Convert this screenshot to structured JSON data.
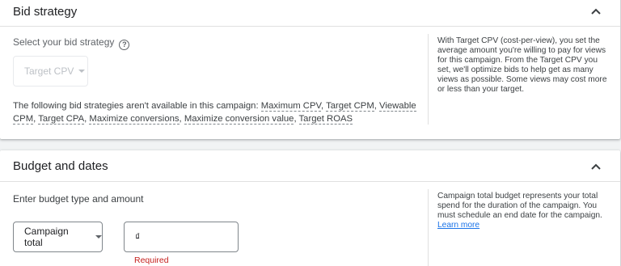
{
  "bid_strategy": {
    "title": "Bid strategy",
    "select_label": "Select your bid strategy",
    "help_glyph": "?",
    "selected": "Target CPV",
    "unavailable_prefix": "The following bid strategies aren't available in this campaign: ",
    "unavailable": [
      "Maximum CPV",
      "Target CPM",
      "Viewable CPM",
      "Target CPA",
      "Maximize conversions",
      "Maximize conversion value",
      "Target ROAS"
    ],
    "sep": ", ",
    "side_text": "With Target CPV (cost-per-view), you set the average amount you're willing to pay for views for this campaign. From the Target CPV you set, we'll optimize bids to help get as many views as possible. Some views may cost more or less than your target."
  },
  "budget": {
    "title": "Budget and dates",
    "enter_label": "Enter budget type and amount",
    "budget_type": "Campaign total",
    "currency_symbol": "₫",
    "required_text": "Required",
    "side_text": "Campaign total budget represents your total spend for the duration of the campaign. You must schedule an end date for the campaign.",
    "learn_more": "Learn more"
  },
  "colors": {
    "link": "#1a73e8",
    "error": "#c5221f"
  },
  "icons": {
    "collapse": "chevron-up-icon",
    "help": "help-circle-icon",
    "dropdown": "dropdown-arrow-icon"
  }
}
